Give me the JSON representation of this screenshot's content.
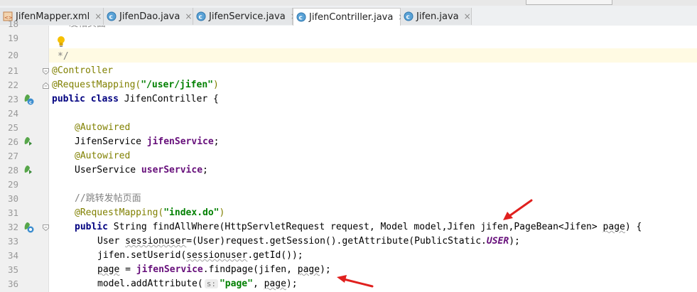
{
  "tabs": [
    {
      "label": "JifenMapper.xml",
      "icon": "xml-file-icon",
      "active": false
    },
    {
      "label": "JifenDao.java",
      "icon": "class-icon",
      "active": false
    },
    {
      "label": "JifenService.java",
      "icon": "class-icon",
      "active": false
    },
    {
      "label": "JifenContriller.java",
      "icon": "class-icon",
      "active": true
    },
    {
      "label": "Jifen.java",
      "icon": "class-icon",
      "active": false
    }
  ],
  "close_glyph": "×",
  "line_numbers": [
    "18",
    "19",
    "20",
    "21",
    "22",
    "23",
    "24",
    "25",
    "26",
    "27",
    "28",
    "29",
    "30",
    "31",
    "32",
    "33",
    "34",
    "35",
    "36"
  ],
  "code": {
    "l18": "发帖页面",
    "l20": "*/",
    "l21": "@Controller",
    "l22_ann": "@RequestMapping(",
    "l22_str": "\"/user/jifen\"",
    "l22_end": ")",
    "l23_kw": "public class",
    "l23_rest": " JifenContriller {",
    "l25": "@Autowired",
    "l26_type": "JifenService ",
    "l26_field": "jifenService",
    "l26_end": ";",
    "l27": "@Autowired",
    "l28_type": "UserService ",
    "l28_field": "userService",
    "l28_end": ";",
    "l30": "//跳转发帖页面",
    "l31_ann": "@RequestMapping(",
    "l31_str": "\"index.do\"",
    "l31_end": ")",
    "l32_kw": "public",
    "l32_rest": " String findAllWhere(HttpServletRequest request, Model model,Jifen jifen,PageBean<Jifen> ",
    "l32_page": "page",
    "l32_end": ") {",
    "l33_a": "User ",
    "l33_var": "sessionuser",
    "l33_b": "=(User)request.getSession().getAttribute(PublicStatic.",
    "l33_const": "USER",
    "l33_c": ");",
    "l34_a": "jifen.setUserid(",
    "l34_var": "sessionuser",
    "l34_b": ".getId());",
    "l35_page": "page",
    "l35_a": " = ",
    "l35_field": "jifenService",
    "l35_b": ".findpage(jifen, ",
    "l35_page2": "page",
    "l35_c": ");",
    "l36_a": "model.addAttribute(",
    "l36_hint": "s:",
    "l36_str": "\"page\"",
    "l36_b": ", ",
    "l36_page": "page",
    "l36_c": ");"
  },
  "colors": {
    "keyword": "#000080",
    "annotation": "#808000",
    "string": "#008000",
    "comment": "#808080",
    "field": "#660e7a",
    "annotation_arrow": "#e0201e",
    "current_line": "#fffae3"
  }
}
